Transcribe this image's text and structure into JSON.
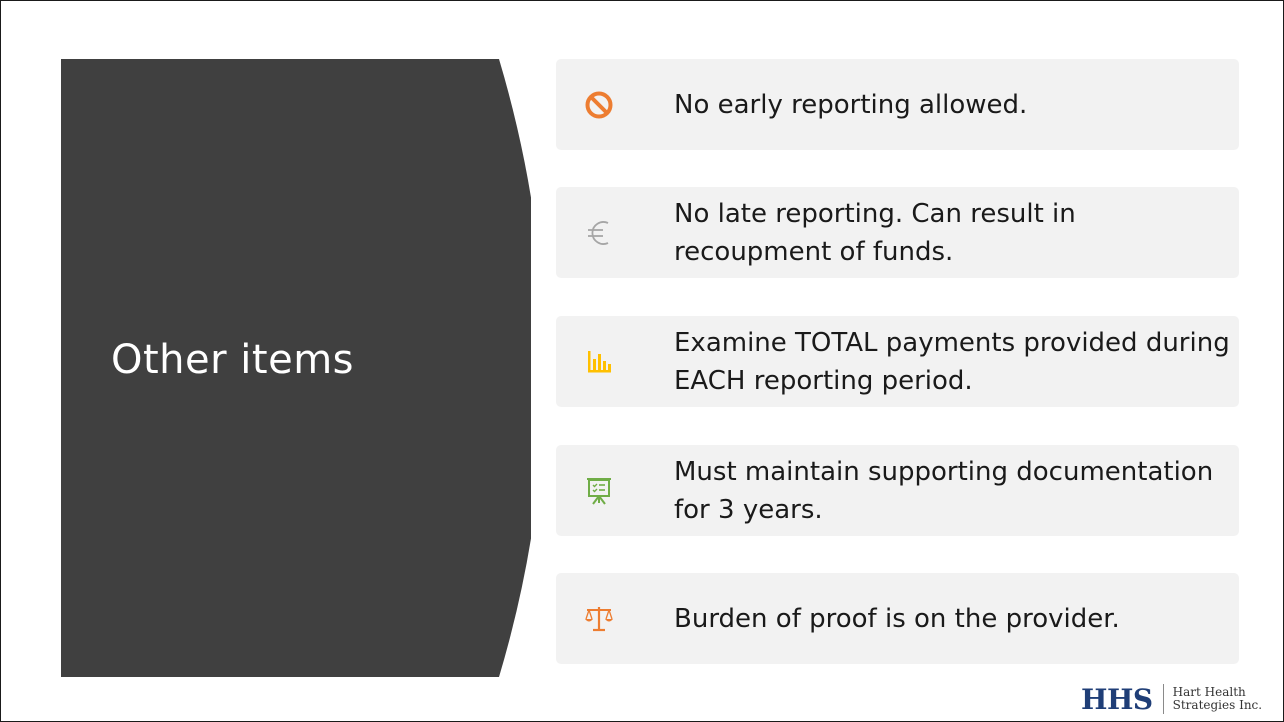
{
  "slide": {
    "title": "Other items"
  },
  "items": [
    {
      "icon": "no-entry-icon",
      "text": "No early reporting allowed."
    },
    {
      "icon": "euro-icon",
      "text": "No late reporting.  Can result in recoupment of funds."
    },
    {
      "icon": "bar-chart-icon",
      "text": "Examine TOTAL payments provided during EACH reporting period."
    },
    {
      "icon": "presentation-board-icon",
      "text": "Must maintain supporting documentation for 3 years."
    },
    {
      "icon": "scales-of-justice-icon",
      "text": "Burden of proof is on the provider."
    }
  ],
  "logo": {
    "mark": "HHS",
    "company_line1": "Hart Health",
    "company_line2": "Strategies Inc."
  },
  "colors": {
    "title_panel": "#404040",
    "item_background": "#f2f2f2",
    "no_entry_icon": "#ed7d31",
    "euro_icon": "#a6a6a6",
    "bar_chart_icon": "#ffc000",
    "presentation_icon": "#70ad47",
    "scales_icon": "#ed7d31",
    "logo_mark": "#1f3e77"
  }
}
